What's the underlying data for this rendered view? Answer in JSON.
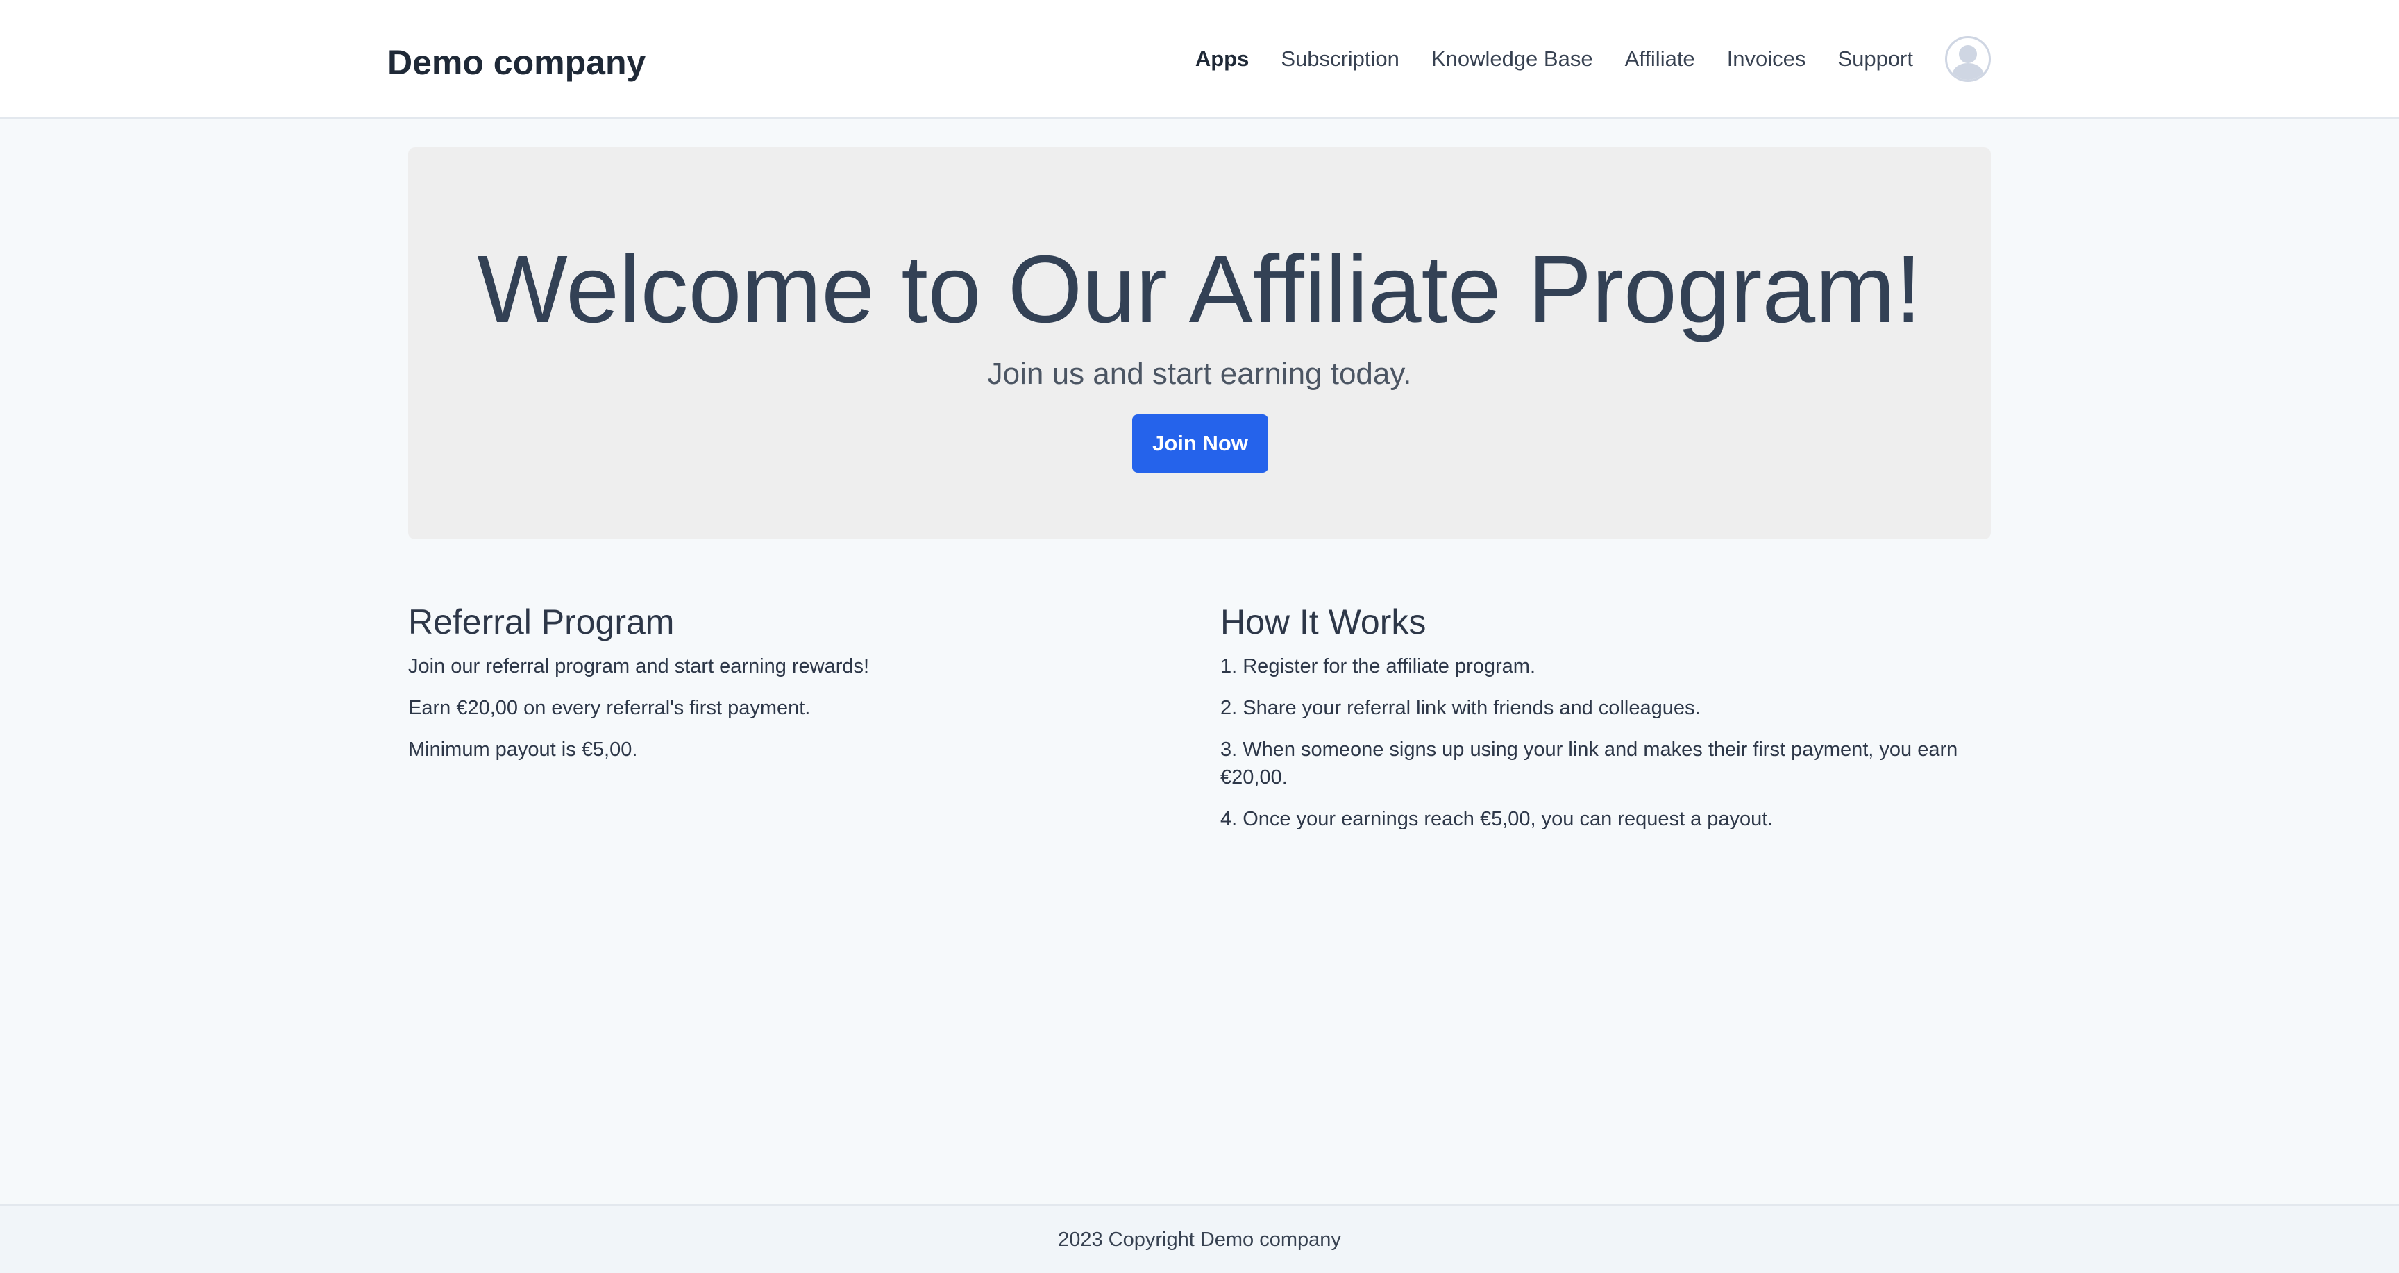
{
  "header": {
    "brand": "Demo company",
    "nav": [
      {
        "label": "Apps",
        "active": true
      },
      {
        "label": "Subscription"
      },
      {
        "label": "Knowledge Base"
      },
      {
        "label": "Affiliate"
      },
      {
        "label": "Invoices"
      },
      {
        "label": "Support"
      }
    ],
    "avatar_icon": "user-avatar-icon"
  },
  "hero": {
    "title": "Welcome to Our Affiliate Program!",
    "subtitle": "Join us and start earning today.",
    "cta_label": "Join Now"
  },
  "referral": {
    "title": "Referral Program",
    "lines": [
      "Join our referral program and start earning rewards!",
      "Earn €20,00 on every referral's first payment.",
      "Minimum payout is €5,00."
    ]
  },
  "how_it_works": {
    "title": "How It Works",
    "steps": [
      "1. Register for the affiliate program.",
      "2. Share your referral link with friends and colleagues.",
      "3. When someone signs up using your link and makes their first payment, you earn €20,00.",
      "4. Once your earnings reach €5,00, you can request a payout."
    ]
  },
  "footer": {
    "text": "2023 Copyright Demo company"
  },
  "colors": {
    "accent": "#2563eb",
    "page_bg": "#f6f9fb",
    "hero_bg": "#eeeeee"
  }
}
